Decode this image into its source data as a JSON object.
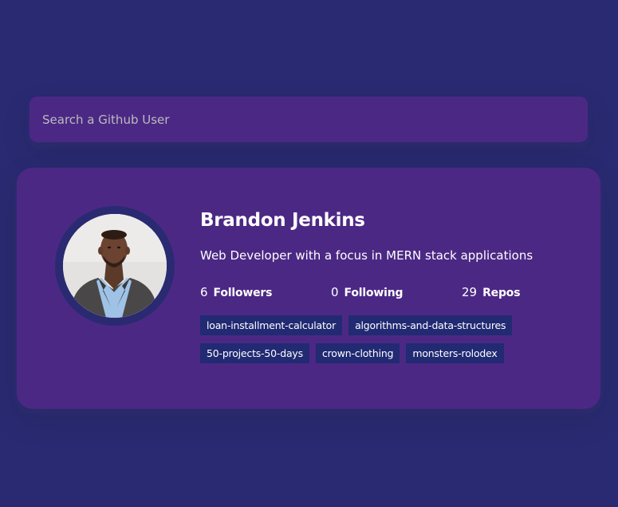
{
  "search": {
    "placeholder": "Search a Github User"
  },
  "user": {
    "name": "Brandon Jenkins",
    "bio": "Web Developer with a focus in MERN stack applications",
    "avatar_icon": "user-avatar-photo"
  },
  "stats": {
    "followers": {
      "count": "6",
      "label": "Followers"
    },
    "following": {
      "count": "0",
      "label": "Following"
    },
    "repos": {
      "count": "29",
      "label": "Repos"
    }
  },
  "repos": [
    "loan-installment-calculator",
    "algorithms-and-data-structures",
    "50-projects-50-days",
    "crown-clothing",
    "monsters-rolodex"
  ],
  "colors": {
    "background": "#2a2a72",
    "card": "#4c2885",
    "repo_tag": "#212a72",
    "text": "#ffffff",
    "placeholder": "#bbbbbb"
  }
}
